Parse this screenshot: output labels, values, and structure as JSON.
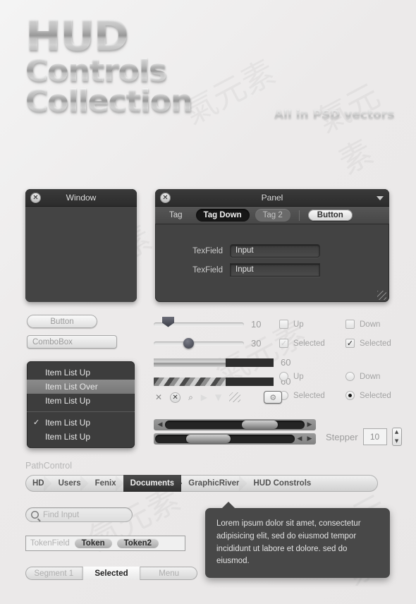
{
  "header": {
    "title_line1": "HUD",
    "title_line2": "Controls",
    "title_line3": "Collection",
    "tagline": "All in PSD vectors"
  },
  "window": {
    "title": "Window",
    "close_icon": "close-icon",
    "resize_grip": "resize-grip-icon"
  },
  "panel": {
    "title": "Panel",
    "close_icon": "close-icon",
    "dropdown_icon": "chevron-down-icon",
    "toolbar": {
      "tag1": "Tag",
      "tag_down": "Tag Down",
      "tag2": "Tag 2",
      "button": "Button"
    },
    "fields": [
      {
        "label": "TexField",
        "value": "Input"
      },
      {
        "label": "TexField",
        "value": "Input"
      }
    ]
  },
  "controls": {
    "button_label": "Button",
    "combobox_label": "ComboBox"
  },
  "item_list": {
    "items": [
      {
        "label": "Item List Up",
        "state": "up",
        "check": ""
      },
      {
        "label": "Item List Over",
        "state": "over",
        "check": ""
      },
      {
        "label": "Item List Up",
        "state": "up",
        "check": ""
      }
    ],
    "items2": [
      {
        "label": "Item List Up",
        "state": "up",
        "check": "✓"
      },
      {
        "label": "Item List Up",
        "state": "up",
        "check": ""
      }
    ]
  },
  "sliders": [
    {
      "type": "slider-shield",
      "value": "10"
    },
    {
      "type": "slider-round",
      "value": "30"
    },
    {
      "type": "progress-solid",
      "value": "60"
    },
    {
      "type": "progress-striped",
      "value": "60"
    }
  ],
  "checkboxes": [
    {
      "label": "Up",
      "state": "off"
    },
    {
      "label": "Down",
      "state": "off"
    },
    {
      "label": "Selected",
      "state": "faint"
    },
    {
      "label": "Selected",
      "state": "on"
    }
  ],
  "radios": [
    {
      "label": "Up",
      "state": "off"
    },
    {
      "label": "Down",
      "state": "off"
    },
    {
      "label": "Selected",
      "state": "off"
    },
    {
      "label": "Selected",
      "state": "on"
    }
  ],
  "icon_row": [
    {
      "name": "close-x-icon",
      "glyph": "✕"
    },
    {
      "name": "close-circle-icon",
      "glyph": "✕"
    },
    {
      "name": "search-icon",
      "glyph": "⌕"
    },
    {
      "name": "play-triangle-icon",
      "glyph": "▶"
    },
    {
      "name": "down-triangle-icon",
      "glyph": "▼"
    },
    {
      "name": "resize-lines-icon",
      "glyph": ""
    },
    {
      "name": "gear-box-icon",
      "glyph": "⚙"
    }
  ],
  "scrollbars": {
    "left_arrow": "◀",
    "right_arrow": "▶"
  },
  "stepper": {
    "label": "Stepper",
    "value": "10",
    "up_arrow": "▲",
    "down_arrow": "▼"
  },
  "path_control": {
    "label": "PathControl",
    "segments": [
      {
        "label": "HD",
        "active": false
      },
      {
        "label": "Users",
        "active": false
      },
      {
        "label": "Fenix",
        "active": false
      },
      {
        "label": "Documents",
        "active": true
      },
      {
        "label": "GraphicRiver",
        "active": false
      },
      {
        "label": "HUD Constrols",
        "active": false
      }
    ]
  },
  "search": {
    "placeholder": "Find Input",
    "icon": "search-icon"
  },
  "token_field": {
    "label": "TokenField",
    "tokens": [
      "Token",
      "Token2"
    ]
  },
  "segmented": [
    {
      "label": "Segment 1",
      "selected": false
    },
    {
      "label": "Selected",
      "selected": true
    },
    {
      "label": "Menu",
      "selected": false
    }
  ],
  "popover": {
    "text": "Lorem ipsum dolor sit amet, consectetur adipisicing elit, sed do eiusmod tempor incididunt ut labore et dolore. sed do eiusmod."
  }
}
